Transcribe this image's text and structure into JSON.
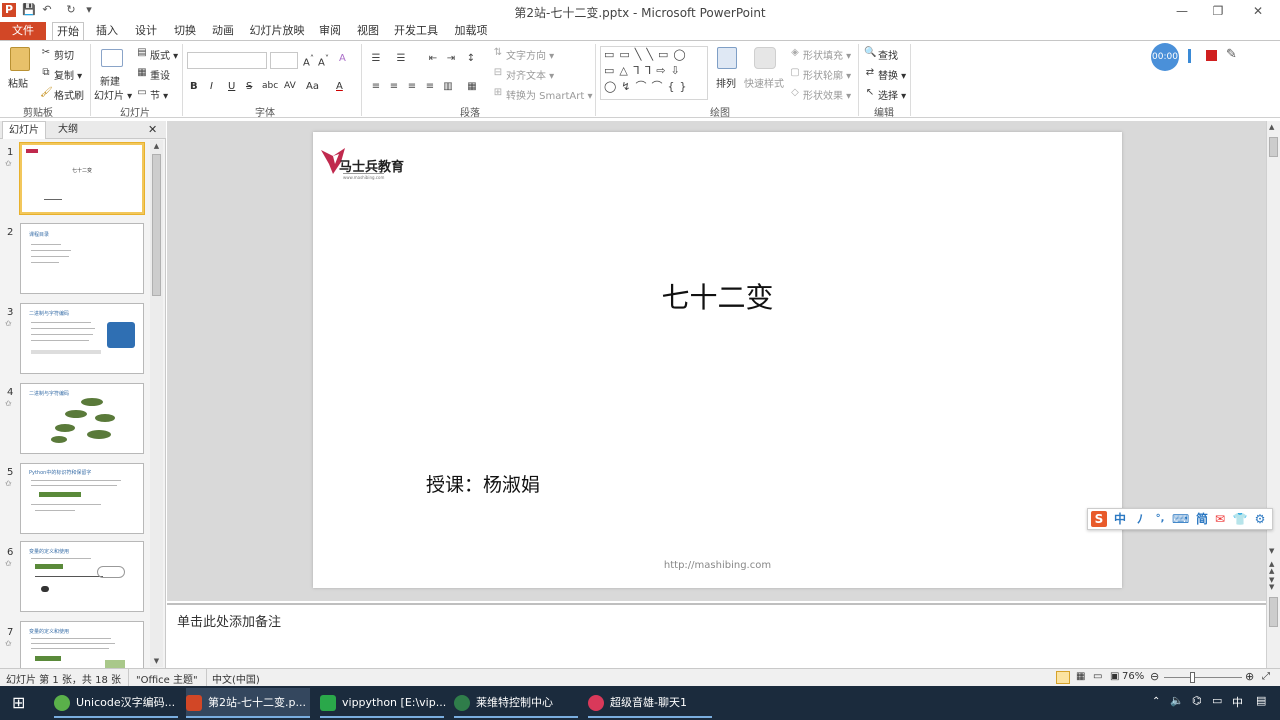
{
  "window": {
    "title": "第2站-七十二变.pptx - Microsoft PowerPoint",
    "minimize": "—",
    "maximize": "❐",
    "close": "✕"
  },
  "quick_access": {
    "app_icon": "P",
    "save": "💾",
    "undo": "↶",
    "redo": "↻",
    "more": "▾"
  },
  "tabs": [
    "文件",
    "开始",
    "插入",
    "设计",
    "切换",
    "动画",
    "幻灯片放映",
    "审阅",
    "视图",
    "开发工具",
    "加载项"
  ],
  "ribbon": {
    "clipboard": {
      "paste": "粘贴",
      "cut": "剪切",
      "copy": "复制 ▾",
      "format_painter": "格式刷",
      "label": "剪贴板"
    },
    "slides": {
      "new_slide": "新建",
      "new_slide2": "幻灯片 ▾",
      "layout": "版式 ▾",
      "reset": "重设",
      "section": "节 ▾",
      "label": "幻灯片"
    },
    "font": {
      "label": "字体",
      "bold": "B",
      "italic": "I",
      "underline": "U",
      "strike": "S",
      "shadow": "abc",
      "spacing": "AV",
      "case": "Aa",
      "color": "A"
    },
    "paragraph": {
      "label": "段落",
      "text_direction": "文字方向 ▾",
      "align_text": "对齐文本 ▾",
      "smartart": "转换为 SmartArt ▾"
    },
    "drawing": {
      "label": "绘图",
      "arrange": "排列",
      "quick_styles": "快速样式",
      "fill": "形状填充 ▾",
      "outline": "形状轮廓 ▾",
      "effects": "形状效果 ▾"
    },
    "editing": {
      "label": "编辑",
      "find": "查找",
      "replace": "替换 ▾",
      "select": "选择 ▾"
    },
    "recorder": {
      "time": "00:00"
    }
  },
  "left_pane": {
    "tab_slides": "幻灯片",
    "tab_outline": "大纲",
    "close": "✕",
    "thumbnails": [
      {
        "num": "1",
        "title": "七十二变",
        "selected": true
      },
      {
        "num": "2",
        "title": "课程目录"
      },
      {
        "num": "3",
        "title": "二进制与字符编码"
      },
      {
        "num": "4",
        "title": "二进制与字符编码"
      },
      {
        "num": "5",
        "title": "Python中的标识符和保留字"
      },
      {
        "num": "6",
        "title": "变量的定义和使用"
      },
      {
        "num": "7",
        "title": "变量的定义和使用"
      }
    ]
  },
  "slide": {
    "logo_text": "马士兵教育",
    "logo_url": "www.mashibing.com",
    "title": "七十二变",
    "subtitle": "授课：杨淑娟",
    "footer": "http://mashibing.com"
  },
  "notes": {
    "placeholder": "单击此处添加备注"
  },
  "status": {
    "slide_info": "幻灯片 第 1 张，共 18 张",
    "theme": "\"Office 主题\"",
    "language": "中文(中国)",
    "zoom": "76%"
  },
  "ime": [
    "中",
    "ﾉ",
    "°,",
    "⌨",
    "简",
    "✉",
    "👕",
    "⚙"
  ],
  "taskbar": {
    "items": [
      {
        "label": "Unicode汉字编码..."
      },
      {
        "label": "第2站-七十二变.p..."
      },
      {
        "label": "vippython [E:\\vip..."
      },
      {
        "label": "莱维特控制中心"
      },
      {
        "label": "超级音雄-聊天1"
      }
    ],
    "tray_lang": "中"
  },
  "colors": {
    "file_tab": "#d24726",
    "accent": "#2b579a",
    "slide_bg": "#ffffff",
    "taskbar": "#1b2b3d"
  }
}
